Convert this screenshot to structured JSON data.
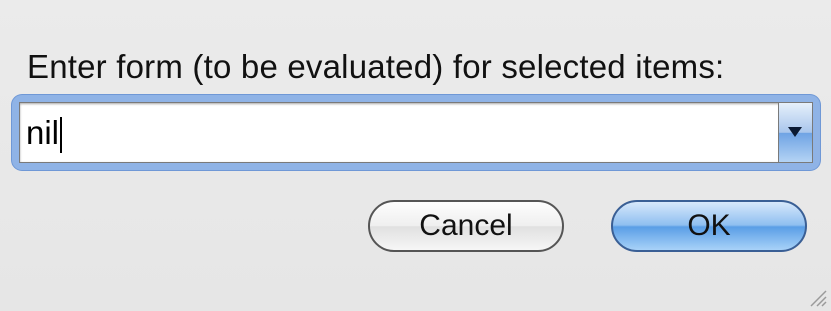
{
  "dialog": {
    "prompt": "Enter form (to be evaluated) for selected items:",
    "input_value": "nil",
    "cancel_label": "Cancel",
    "ok_label": "OK"
  },
  "colors": {
    "background": "#e8e8e8",
    "focus_ring": "#8fb3e6",
    "default_button": "#5a9ee6"
  },
  "icons": {
    "dropdown": "chevron-down-icon",
    "resize": "resize-grip-icon"
  }
}
